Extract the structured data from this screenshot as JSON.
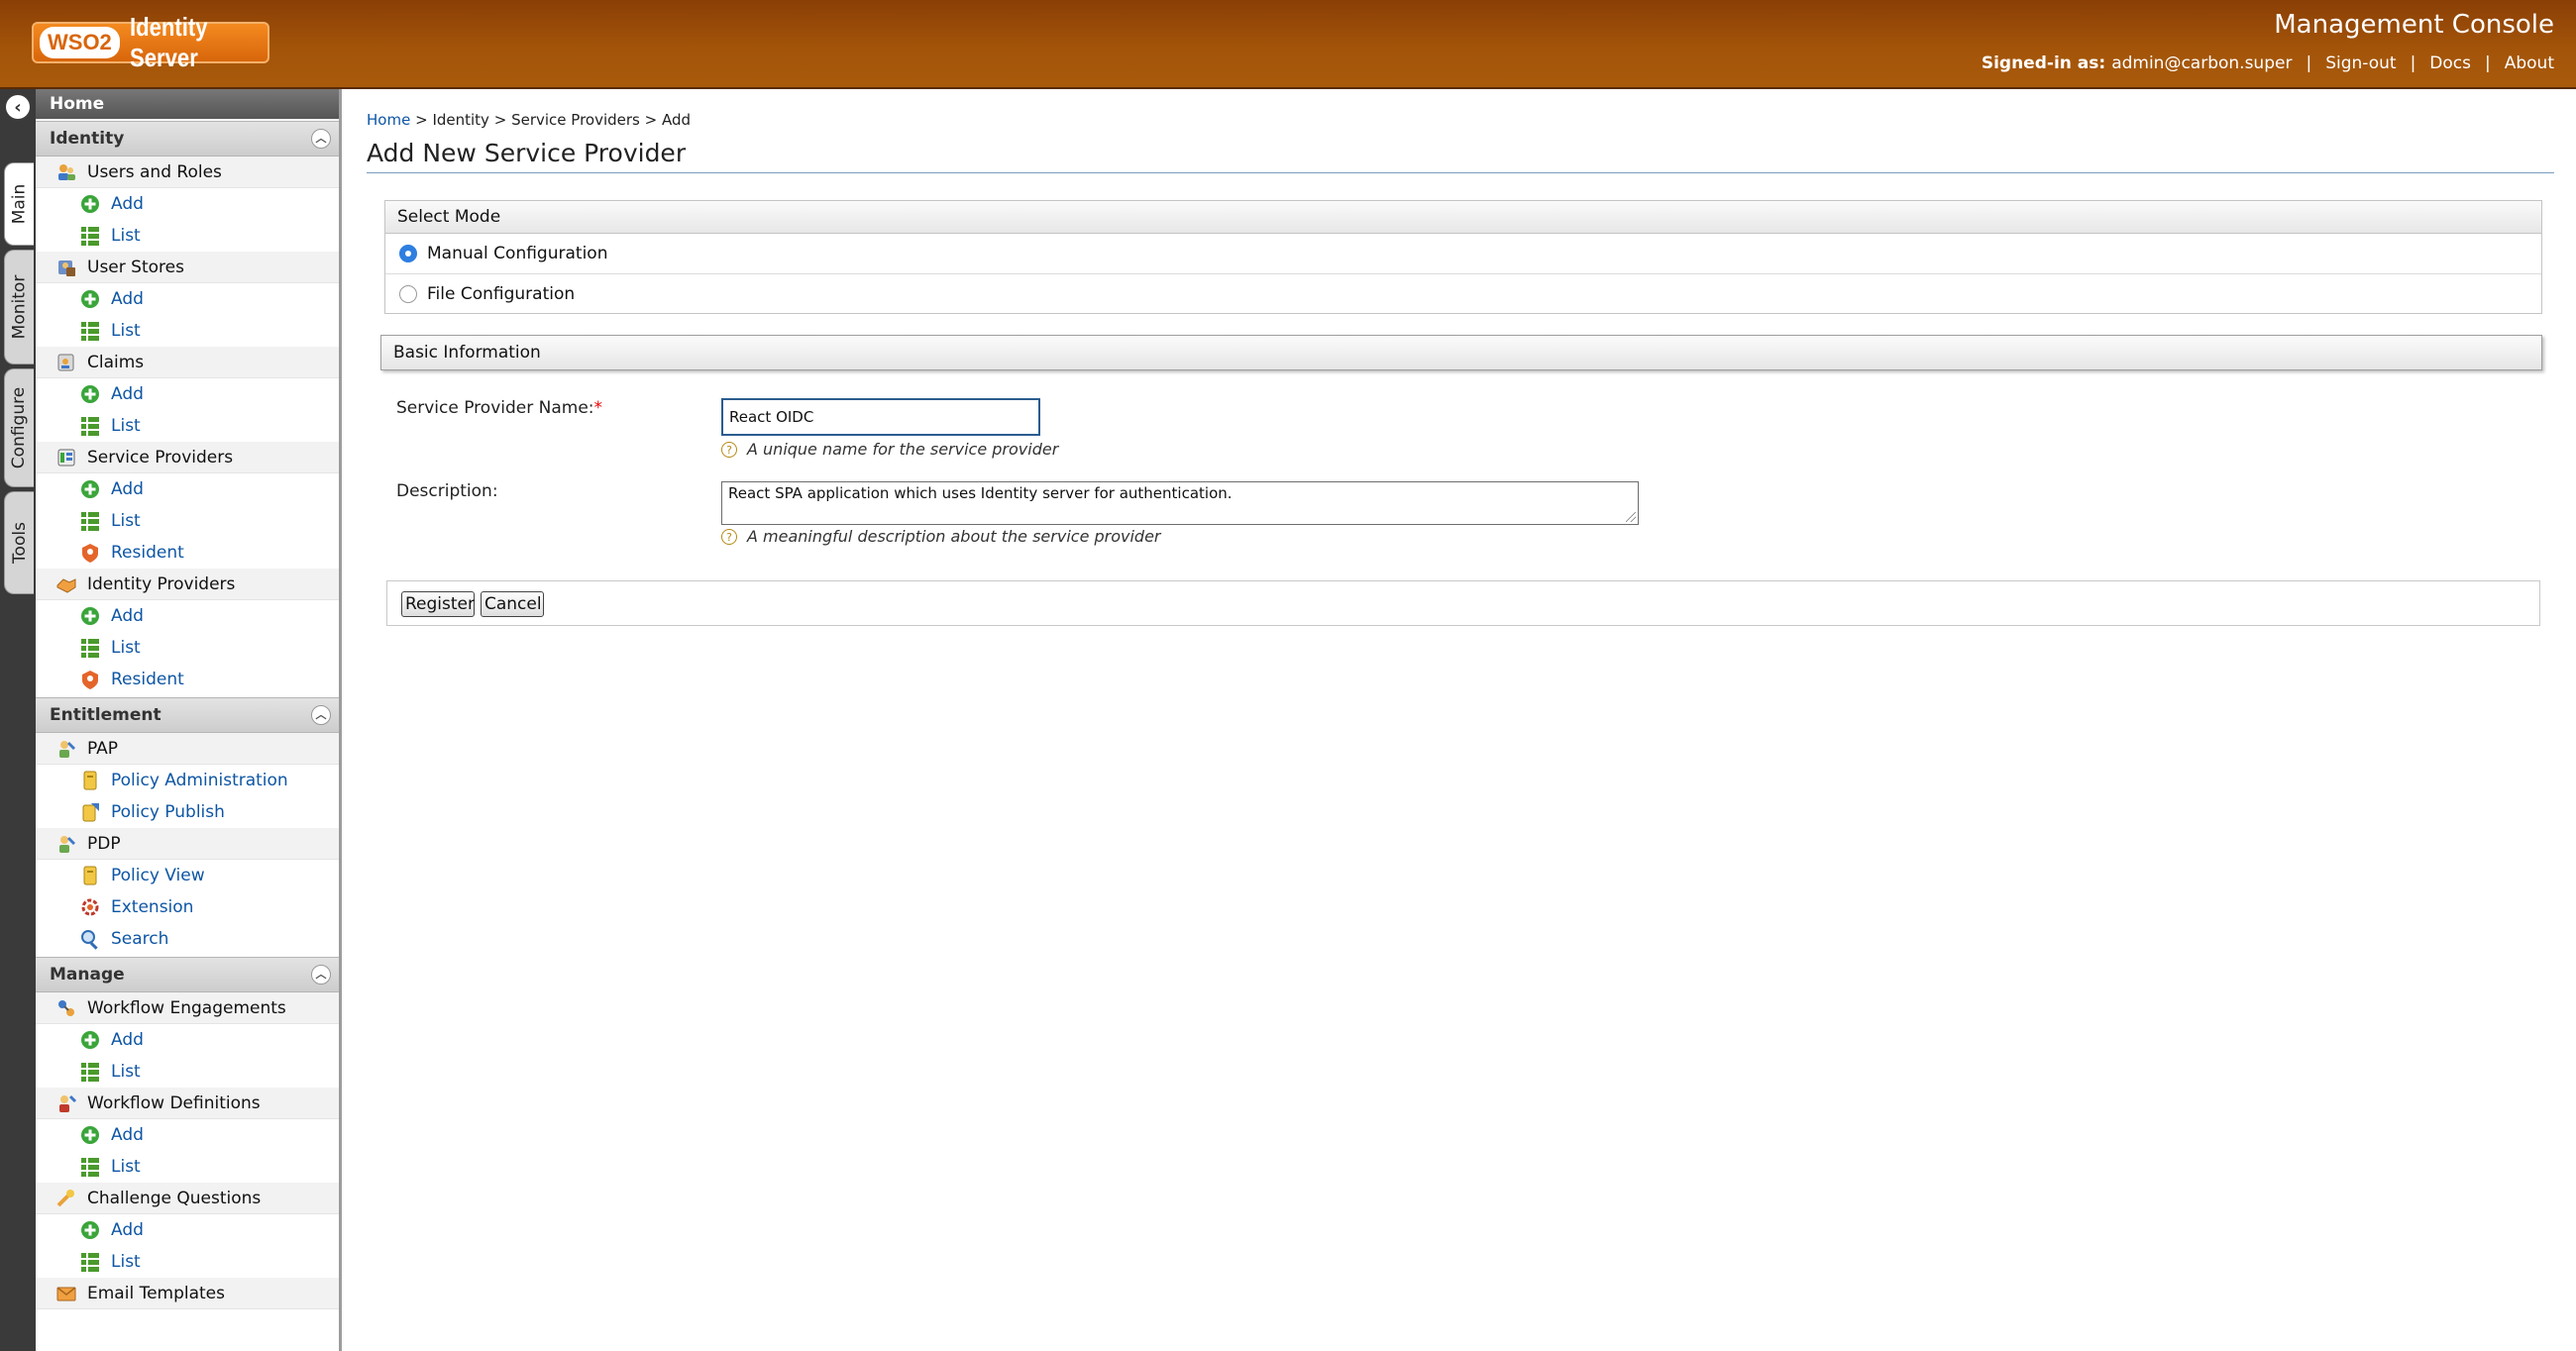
{
  "header": {
    "product_badge": "WSO2",
    "product_name": "Identity Server",
    "console_title": "Management Console",
    "signed_in_label": "Signed-in as:",
    "signed_in_user": "admin@carbon.super",
    "sign_out": "Sign-out",
    "docs": "Docs",
    "about": "About"
  },
  "vtabs": [
    "Main",
    "Monitor",
    "Configure",
    "Tools"
  ],
  "sidebar": {
    "home": "Home",
    "identity": {
      "title": "Identity",
      "users_roles": "Users and Roles",
      "users_add": "Add",
      "users_list": "List",
      "user_stores": "User Stores",
      "stores_add": "Add",
      "stores_list": "List",
      "claims": "Claims",
      "claims_add": "Add",
      "claims_list": "List",
      "service_providers": "Service Providers",
      "sp_add": "Add",
      "sp_list": "List",
      "sp_resident": "Resident",
      "identity_providers": "Identity Providers",
      "idp_add": "Add",
      "idp_list": "List",
      "idp_resident": "Resident"
    },
    "entitlement": {
      "title": "Entitlement",
      "pap": "PAP",
      "policy_admin": "Policy Administration",
      "policy_publish": "Policy Publish",
      "pdp": "PDP",
      "policy_view": "Policy View",
      "extension": "Extension",
      "search": "Search"
    },
    "manage": {
      "title": "Manage",
      "workflow_engagements": "Workflow Engagements",
      "we_add": "Add",
      "we_list": "List",
      "workflow_definitions": "Workflow Definitions",
      "wd_add": "Add",
      "wd_list": "List",
      "challenge_questions": "Challenge Questions",
      "cq_add": "Add",
      "cq_list": "List",
      "email_templates": "Email Templates"
    }
  },
  "breadcrumb": {
    "home": "Home",
    "sep": ">",
    "identity": "Identity",
    "service_providers": "Service Providers",
    "current": "Add"
  },
  "page_title": "Add New Service Provider",
  "select_mode": {
    "title": "Select Mode",
    "manual": "Manual Configuration",
    "file": "File Configuration",
    "selected": "Manual Configuration"
  },
  "basic_info": {
    "title": "Basic Information",
    "sp_name_label": "Service Provider Name:",
    "required_mark": "*",
    "sp_name_value": "React OIDC",
    "sp_name_hint": "A unique name for the service provider",
    "description_label": "Description:",
    "description_value": "React SPA application which uses Identity server for authentication.",
    "description_hint": "A meaningful description about the service provider"
  },
  "buttons": {
    "register": "Register",
    "cancel": "Cancel"
  },
  "colors": {
    "header_brown": "#a35409",
    "link_blue": "#0e56a4",
    "radio_blue": "#2e7fe0",
    "add_green": "#3aa53a",
    "resident_orange": "#e4652a"
  }
}
